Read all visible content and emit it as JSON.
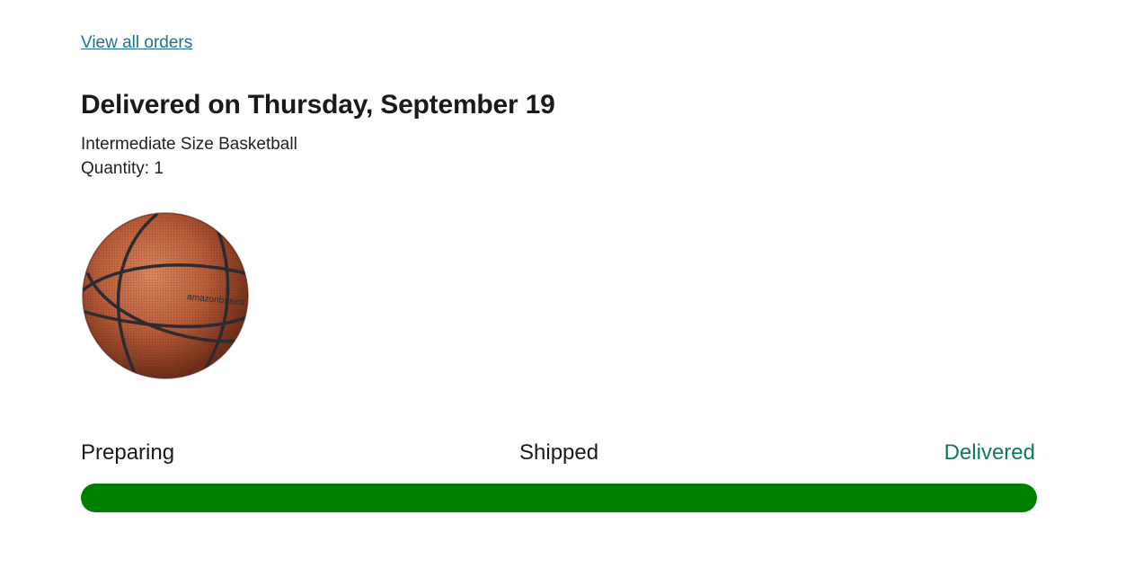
{
  "nav": {
    "view_all_orders": "View all orders"
  },
  "order": {
    "title": "Delivered on Thursday, September 19",
    "product_name": "Intermediate Size Basketball",
    "quantity_text": "Quantity: 1",
    "image_alt": "basketball",
    "logo_text": "amazonbasics"
  },
  "tracking": {
    "steps": [
      {
        "label": "Preparing"
      },
      {
        "label": "Shipped"
      },
      {
        "label": "Delivered"
      }
    ],
    "current_step": "Delivered",
    "progress_fraction": 1.0,
    "progress_color": "#008000",
    "current_step_color": "#0f7a5a"
  },
  "colors": {
    "link": "#1c6f9c",
    "text": "#1a1a1a"
  }
}
